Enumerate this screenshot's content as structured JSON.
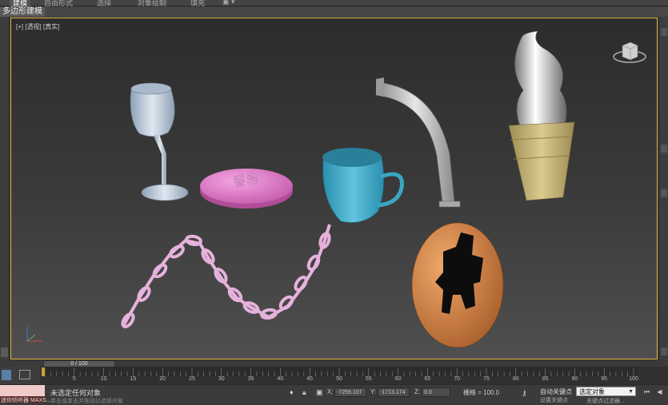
{
  "ribbon": {
    "tabs": [
      {
        "label": "建模",
        "active": true
      },
      {
        "label": "自由形式",
        "active": false
      },
      {
        "label": "选择",
        "active": false
      },
      {
        "label": "对象绘制",
        "active": false
      },
      {
        "label": "填充",
        "active": false
      }
    ]
  },
  "mode": {
    "label": "多边形建模"
  },
  "viewport": {
    "label": "[+] [透视] [真实]"
  },
  "scene": {
    "soap_text": "香皂"
  },
  "timeline": {
    "frame_display": "0 / 100",
    "ticks": [
      "5",
      "10",
      "15",
      "20",
      "25",
      "30",
      "35",
      "40",
      "45",
      "50",
      "55",
      "60",
      "65",
      "70",
      "75",
      "80",
      "85",
      "90",
      "95",
      "100"
    ]
  },
  "status": {
    "maxscript": "迷你侦听器 MAXS...",
    "message": "未选定任何对象",
    "sub_message": "单击或单击并拖动以选择对象",
    "x_label": "X:",
    "x_value": "-7259.107",
    "y_label": "Y:",
    "y_value": "-1713.174",
    "z_label": "Z:",
    "z_value": "0.0",
    "grid": "栅格 = 100.0",
    "auto_key": "自动关键点",
    "set_key": "设置关键点",
    "selection_set": "选定对象",
    "key_filters": "关键点过滤器..."
  },
  "colors": {
    "viewport_border": "#e1b43a",
    "wine_glass": "#b8c6d6",
    "soap": "#e07fc9",
    "cup": "#3ea8c6",
    "column": "#bdbdbd",
    "cone": "#c9b77a",
    "chain": "#e8b4dc",
    "egg": "#d88a4a"
  }
}
